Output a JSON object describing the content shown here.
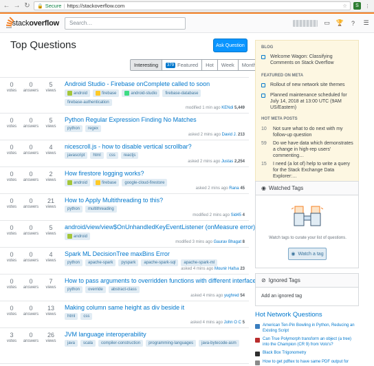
{
  "browser": {
    "secure_label": "Secure",
    "url": "https://stackoverflow.com"
  },
  "topbar": {
    "logo_light": "stack",
    "logo_bold": "overflow",
    "search_placeholder": "Search…"
  },
  "main": {
    "title": "Top Questions",
    "ask_button": "Ask Question",
    "tabs": [
      {
        "label": "Interesting",
        "active": true
      },
      {
        "label": "Featured",
        "badge": "379"
      },
      {
        "label": "Hot"
      },
      {
        "label": "Week"
      },
      {
        "label": "Month"
      }
    ],
    "stat_labels": {
      "votes": "votes",
      "answers": "answers",
      "views": "views"
    }
  },
  "questions": [
    {
      "votes": "0",
      "answers": "0",
      "views": "5",
      "title": "Android Studio - Firebase onComplete called to soon",
      "tags": [
        "android",
        "firebase",
        "android-studio",
        "firebase-database",
        "firebase-authentication"
      ],
      "time": "modified 1 min ago",
      "user": "KENdi",
      "rep": "5,449"
    },
    {
      "votes": "0",
      "answers": "0",
      "views": "5",
      "title": "Python Regular Expression Finding No Matches",
      "tags": [
        "python",
        "regex"
      ],
      "time": "asked 2 mins ago",
      "user": "David J.",
      "rep": "213"
    },
    {
      "votes": "0",
      "answers": "0",
      "views": "4",
      "title": "nicescroll.js - how to disable vertical scrollbar?",
      "tags": [
        "javascript",
        "html",
        "css",
        "reactjs"
      ],
      "time": "asked 2 mins ago",
      "user": "Justas",
      "rep": "2,254"
    },
    {
      "votes": "0",
      "answers": "0",
      "views": "2",
      "title": "How firestore logging works?",
      "tags": [
        "android",
        "firebase",
        "google-cloud-firestore"
      ],
      "time": "asked 2 mins ago",
      "user": "Rana",
      "rep": "45"
    },
    {
      "votes": "0",
      "answers": "0",
      "views": "21",
      "title": "How to Apply Multithreading to this?",
      "tags": [
        "python",
        "multithreading"
      ],
      "time": "modified 2 mins ago",
      "user": "Sid45",
      "rep": "4"
    },
    {
      "votes": "0",
      "answers": "0",
      "views": "5",
      "title": "android/view/view$OnUnhandledKeyEventListener (onMeasure error)",
      "tags": [
        "android"
      ],
      "time": "modified 3 mins ago",
      "user": "Gaurav Bhagat",
      "rep": "8"
    },
    {
      "votes": "0",
      "answers": "0",
      "views": "4",
      "title": "Spark ML DecisionTree maxBins Error",
      "tags": [
        "python",
        "apache-spark",
        "pyspark",
        "apache-spark-sql",
        "apache-spark-ml"
      ],
      "time": "asked 4 mins ago",
      "user": "Mounir Hafsa",
      "rep": "23"
    },
    {
      "votes": "0",
      "answers": "0",
      "views": "7",
      "title": "How to pass arguments to overridden functions with different interface?",
      "tags": [
        "python",
        "override",
        "abstract-class"
      ],
      "time": "asked 4 mins ago",
      "user": "yughred",
      "rep": "54"
    },
    {
      "votes": "0",
      "answers": "0",
      "views": "13",
      "title": "Making column same height as div beside it",
      "tags": [
        "html",
        "css"
      ],
      "time": "asked 4 mins ago",
      "user": "John O C",
      "rep": "5"
    },
    {
      "votes": "3",
      "answers": "0",
      "views": "26",
      "title": "JVM language interoperability",
      "tags": [
        "java",
        "scala",
        "compiler-construction",
        "programming-languages",
        "java-bytecode-asm"
      ],
      "time": "",
      "user": "",
      "rep": ""
    }
  ],
  "sidebar": {
    "blog_heading": "BLOG",
    "blog_items": [
      "Welcome Wagon: Classifying Comments on Stack Overflow"
    ],
    "meta_heading": "FEATURED ON META",
    "meta_items": [
      "Rollout of new network site themes",
      "Planned maintenance scheduled for July 14, 2018 at 13:00 UTC (9AM US/Eastern)"
    ],
    "hot_meta_heading": "HOT META POSTS",
    "hot_meta": [
      {
        "count": "10",
        "text": "Not sure what to do next with my follow-up question"
      },
      {
        "count": "59",
        "text": "Do we have data which demonstrates a change in high-rep users' commenting…"
      },
      {
        "count": "15",
        "text": "I need (a lot of) help to write a query for the Stack Exchange Data Explorer:…"
      }
    ],
    "watched_title": "Watched Tags",
    "watched_text": "Watch tags to curate your list of questions.",
    "watch_button": "Watch a tag",
    "ignored_title": "Ignored Tags",
    "ignored_link": "Add an ignored tag",
    "hnq_title": "Hot Network Questions",
    "hnq": [
      {
        "text": "American Ten-Pin Bowling in Python, Reducing an Existing Script",
        "icon_color": "#3a7ebf"
      },
      {
        "text": "Can True Polymorph transform an object (a tree) into the Champion (CR 9) from Volo's?",
        "icon_color": "#b92d2d"
      },
      {
        "text": "Black Box Trigonometry",
        "icon_color": "#2f2f2f"
      },
      {
        "text": "How to get pdftex to have same PDF output for",
        "icon_color": "#8a8a8a"
      }
    ]
  },
  "tag_colors": {
    "android": "#a4c639",
    "firebase": "#ffca28",
    "android-studio": "#3ddc84"
  }
}
